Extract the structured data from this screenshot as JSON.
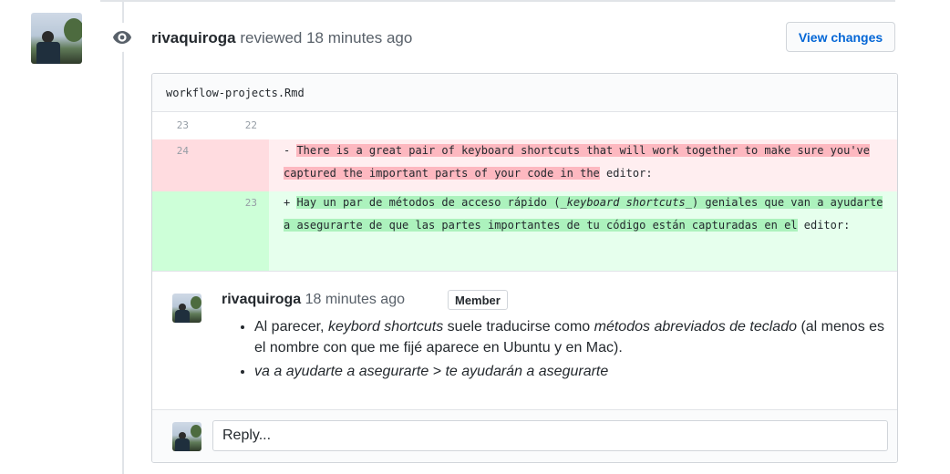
{
  "review": {
    "author": "rivaquiroga",
    "action_text": "reviewed 18 minutes ago",
    "view_changes_label": "View changes",
    "event_icon": "eye-icon"
  },
  "file": {
    "name": "workflow-projects.Rmd",
    "context_line": {
      "old": "23",
      "new": "22"
    },
    "deleted_line": {
      "old": "24",
      "prefix": "- ",
      "highlighted": "There is a great pair of keyboard shortcuts that will work together to make sure you've captured the important parts of your code in the",
      "rest": " editor:"
    },
    "added_line": {
      "new": "23",
      "prefix": "+ ",
      "part1": "Hay un par de métodos de acceso rápido (",
      "part1_italic": "_keyboard shortcuts_",
      "part2": ") geniales que van a ayudarte a asegurarte de que las partes importantes de tu código están capturadas en el",
      "rest": " editor:"
    }
  },
  "comment": {
    "author": "rivaquiroga",
    "time": "18 minutes ago",
    "badge": "Member",
    "bullet1": {
      "t1": "Al parecer, ",
      "i1": "keybord shortcuts",
      "t2": " suele traducirse como ",
      "i2": "métodos abreviados de teclado",
      "t3": " (al menos es el nombre con que me fijé aparece en Ubuntu y en Mac)."
    },
    "bullet2": "va a ayudarte a asegurarte > te ayudarán a asegurarte"
  },
  "reply": {
    "placeholder": "Reply..."
  },
  "colors": {
    "link_blue": "#0366d6",
    "deletion_bg": "#ffeef0",
    "addition_bg": "#e6ffed"
  }
}
